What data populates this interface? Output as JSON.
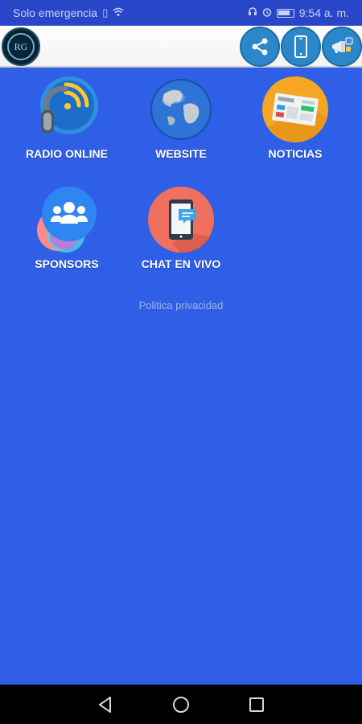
{
  "status_bar": {
    "carrier": "Solo emergencia",
    "time": "9:54 a. m."
  },
  "app_bar": {
    "logo_text": "RG",
    "icons": [
      "share-icon",
      "phone-icon",
      "megaphone-icon"
    ]
  },
  "tiles": [
    {
      "label": "RADIO ONLINE",
      "icon": "radio-headphones-icon"
    },
    {
      "label": "WEBSITE",
      "icon": "globe-icon"
    },
    {
      "label": "NOTICIAS",
      "icon": "newspaper-icon"
    },
    {
      "label": "SPONSORS",
      "icon": "people-icon"
    },
    {
      "label": "CHAT EN VIVO",
      "icon": "chat-phone-icon"
    }
  ],
  "footer": {
    "privacy_link": "Politica privacidad"
  },
  "colors": {
    "background": "#2f5fe6",
    "status_bar": "#2a46c8",
    "accent_button": "#2b87c9"
  }
}
